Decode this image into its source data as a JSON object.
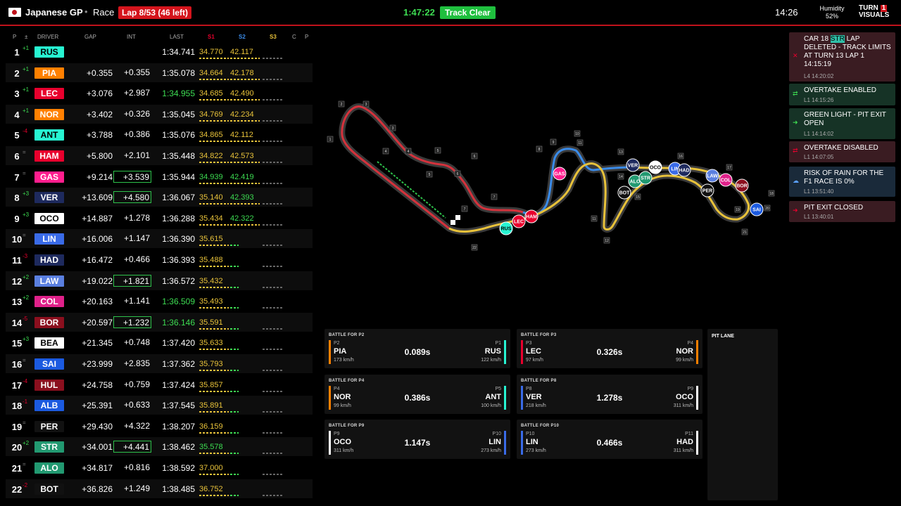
{
  "header": {
    "gp_name": "Japanese GP",
    "separator": "•",
    "session": "Race",
    "lap_badge": "Lap 8/53 (46 left)",
    "session_clock": "1:47:22",
    "track_status": "Track Clear",
    "local_time": "14:26",
    "humidity_label": "Humidity",
    "humidity_value": "52%",
    "brand_line1": "TURN",
    "brand_one": "1",
    "brand_line2": "VISUALS",
    "colors": {
      "accent": "#d4141c",
      "green": "#1fbf3e"
    }
  },
  "table": {
    "headers": {
      "p": "P",
      "chg": "±",
      "driver": "DRIVER",
      "gap": "GAP",
      "int": "INT",
      "last": "LAST",
      "s1": "S1",
      "s2": "S2",
      "s3": "S3",
      "c": "C",
      "pp": "P"
    },
    "rows": [
      {
        "pos": "1",
        "chg": "+1",
        "drv": "RUS",
        "color": "#27f4d2",
        "fg": "#000",
        "gap": "",
        "int": "",
        "last": "1:34.741",
        "s1": "34.770",
        "s2": "42.117",
        "s1c": "#e8c23a",
        "s2c": "#e8c23a",
        "lastc": "#fff",
        "box": false
      },
      {
        "pos": "2",
        "chg": "+1",
        "drv": "PIA",
        "color": "#ff8000",
        "fg": "#fff",
        "gap": "+0.355",
        "int": "+0.355",
        "last": "1:35.078",
        "s1": "34.664",
        "s2": "42.178",
        "s1c": "#e8c23a",
        "s2c": "#e8c23a",
        "lastc": "#fff",
        "box": false
      },
      {
        "pos": "3",
        "chg": "+1",
        "drv": "LEC",
        "color": "#e8002d",
        "fg": "#fff",
        "gap": "+3.076",
        "int": "+2.987",
        "last": "1:34.955",
        "s1": "34.685",
        "s2": "42.490",
        "s1c": "#e8c23a",
        "s2c": "#e8c23a",
        "lastc": "#3ddc52",
        "box": false
      },
      {
        "pos": "4",
        "chg": "+1",
        "drv": "NOR",
        "color": "#ff8000",
        "fg": "#fff",
        "gap": "+3.402",
        "int": "+0.326",
        "last": "1:35.045",
        "s1": "34.769",
        "s2": "42.234",
        "s1c": "#e8c23a",
        "s2c": "#e8c23a",
        "lastc": "#fff",
        "box": false
      },
      {
        "pos": "5",
        "chg": "-4",
        "drv": "ANT",
        "color": "#27f4d2",
        "fg": "#000",
        "gap": "+3.788",
        "int": "+0.386",
        "last": "1:35.076",
        "s1": "34.865",
        "s2": "42.112",
        "s1c": "#e8c23a",
        "s2c": "#e8c23a",
        "lastc": "#fff",
        "box": false
      },
      {
        "pos": "6",
        "chg": "=",
        "drv": "HAM",
        "color": "#e8002d",
        "fg": "#fff",
        "gap": "+5.800",
        "int": "+2.101",
        "last": "1:35.448",
        "s1": "34.822",
        "s2": "42.573",
        "s1c": "#e8c23a",
        "s2c": "#e8c23a",
        "lastc": "#fff",
        "box": false
      },
      {
        "pos": "7",
        "chg": "=",
        "drv": "GAS",
        "color": "#ff1e8e",
        "fg": "#fff",
        "gap": "+9.214",
        "int": "+3.539",
        "last": "1:35.944",
        "s1": "34.939",
        "s2": "42.419",
        "s1c": "#3ddc52",
        "s2c": "#3ddc52",
        "lastc": "#fff",
        "box": true
      },
      {
        "pos": "8",
        "chg": "+3",
        "drv": "VER",
        "color": "#1e2a5e",
        "fg": "#fff",
        "gap": "+13.609",
        "int": "+4.580",
        "last": "1:36.067",
        "s1": "35.140",
        "s2": "42.393",
        "s1c": "#e8c23a",
        "s2c": "#3ddc52",
        "lastc": "#fff",
        "box": true
      },
      {
        "pos": "9",
        "chg": "+3",
        "drv": "OCO",
        "color": "#ffffff",
        "fg": "#000",
        "gap": "+14.887",
        "int": "+1.278",
        "last": "1:36.288",
        "s1": "35.434",
        "s2": "42.322",
        "s1c": "#e8c23a",
        "s2c": "#3ddc52",
        "lastc": "#fff",
        "box": false
      },
      {
        "pos": "10",
        "chg": "=",
        "drv": "LIN",
        "color": "#3a6be8",
        "fg": "#fff",
        "gap": "+16.006",
        "int": "+1.147",
        "last": "1:36.390",
        "s1": "35.615",
        "s2": "",
        "s1c": "#e8c23a",
        "s2c": "#e8c23a",
        "lastc": "#fff",
        "box": false
      },
      {
        "pos": "11",
        "chg": "-3",
        "drv": "HAD",
        "color": "#1e2a5e",
        "fg": "#fff",
        "gap": "+16.472",
        "int": "+0.466",
        "last": "1:36.393",
        "s1": "35.488",
        "s2": "",
        "s1c": "#e8c23a",
        "s2c": "#e8c23a",
        "lastc": "#fff",
        "box": false
      },
      {
        "pos": "12",
        "chg": "+2",
        "drv": "LAW",
        "color": "#5a7fe0",
        "fg": "#fff",
        "gap": "+19.022",
        "int": "+1.821",
        "last": "1:36.572",
        "s1": "35.432",
        "s2": "",
        "s1c": "#e8c23a",
        "s2c": "#e8c23a",
        "lastc": "#fff",
        "box": true
      },
      {
        "pos": "13",
        "chg": "+2",
        "drv": "COL",
        "color": "#e0218a",
        "fg": "#fff",
        "gap": "+20.163",
        "int": "+1.141",
        "last": "1:36.509",
        "s1": "35.493",
        "s2": "",
        "s1c": "#e8c23a",
        "s2c": "#e8c23a",
        "lastc": "#3ddc52",
        "box": false
      },
      {
        "pos": "14",
        "chg": "-5",
        "drv": "BOR",
        "color": "#8b0f1e",
        "fg": "#fff",
        "gap": "+20.597",
        "int": "+1.232",
        "last": "1:36.146",
        "s1": "35.591",
        "s2": "",
        "s1c": "#e8c23a",
        "s2c": "#e8c23a",
        "lastc": "#3ddc52",
        "box": true
      },
      {
        "pos": "15",
        "chg": "+3",
        "drv": "BEA",
        "color": "#ffffff",
        "fg": "#000",
        "gap": "+21.345",
        "int": "+0.748",
        "last": "1:37.420",
        "s1": "35.633",
        "s2": "",
        "s1c": "#e8c23a",
        "s2c": "#e8c23a",
        "lastc": "#fff",
        "box": false
      },
      {
        "pos": "16",
        "chg": "=",
        "drv": "SAI",
        "color": "#1b5ae0",
        "fg": "#fff",
        "gap": "+23.999",
        "int": "+2.835",
        "last": "1:37.362",
        "s1": "35.793",
        "s2": "",
        "s1c": "#e8c23a",
        "s2c": "#e8c23a",
        "lastc": "#fff",
        "box": false
      },
      {
        "pos": "17",
        "chg": "-4",
        "drv": "HUL",
        "color": "#8b0f1e",
        "fg": "#fff",
        "gap": "+24.758",
        "int": "+0.759",
        "last": "1:37.424",
        "s1": "35.857",
        "s2": "",
        "s1c": "#e8c23a",
        "s2c": "#e8c23a",
        "lastc": "#fff",
        "box": false
      },
      {
        "pos": "18",
        "chg": "-1",
        "drv": "ALB",
        "color": "#1b5ae0",
        "fg": "#fff",
        "gap": "+25.391",
        "int": "+0.633",
        "last": "1:37.545",
        "s1": "35.891",
        "s2": "",
        "s1c": "#e8c23a",
        "s2c": "#e8c23a",
        "lastc": "#fff",
        "box": false
      },
      {
        "pos": "19",
        "chg": "=",
        "drv": "PER",
        "color": "#111111",
        "fg": "#fff",
        "gap": "+29.430",
        "int": "+4.322",
        "last": "1:38.207",
        "s1": "36.159",
        "s2": "",
        "s1c": "#e8c23a",
        "s2c": "#e8c23a",
        "lastc": "#fff",
        "box": false
      },
      {
        "pos": "20",
        "chg": "+2",
        "drv": "STR",
        "color": "#229971",
        "fg": "#fff",
        "gap": "+34.001",
        "int": "+4.441",
        "last": "1:38.462",
        "s1": "35.578",
        "s2": "",
        "s1c": "#3ddc52",
        "s2c": "#e8c23a",
        "lastc": "#fff",
        "box": true
      },
      {
        "pos": "21",
        "chg": "=",
        "drv": "ALO",
        "color": "#229971",
        "fg": "#fff",
        "gap": "+34.817",
        "int": "+0.816",
        "last": "1:38.592",
        "s1": "37.000",
        "s2": "",
        "s1c": "#e8c23a",
        "s2c": "#e8c23a",
        "lastc": "#fff",
        "box": false
      },
      {
        "pos": "22",
        "chg": "-2",
        "drv": "BOT",
        "color": "#111111",
        "fg": "#fff",
        "gap": "+36.826",
        "int": "+1.249",
        "last": "1:38.485",
        "s1": "36.752",
        "s2": "",
        "s1c": "#e8c23a",
        "s2c": "#e8c23a",
        "lastc": "#fff",
        "box": false
      }
    ]
  },
  "map": {
    "corners": [
      "1",
      "2",
      "3",
      "3",
      "4",
      "4",
      "5",
      "5",
      "6",
      "6",
      "7",
      "7",
      "8",
      "9",
      "10",
      "11",
      "11",
      "12",
      "13",
      "14",
      "15",
      "16",
      "17",
      "18",
      "19",
      "20",
      "21",
      "22"
    ],
    "cars": [
      "RUS",
      "LEC",
      "HAM",
      "GAS",
      "VER",
      "OCO",
      "LIN",
      "HAD",
      "LAW",
      "COL",
      "BOR",
      "PER",
      "SAI",
      "ALO",
      "STR",
      "BOT"
    ]
  },
  "race_control": [
    {
      "pre": "CAR 18 ",
      "hl": "STR",
      "post": " LAP DELETED - TRACK LIMITS AT TURN 13 LAP 1 14:15:19",
      "time": "L4 14:20:02",
      "kind": "red",
      "icon": "✕"
    },
    {
      "pre": "OVERTAKE ENABLED",
      "hl": "",
      "post": "",
      "time": "L1 14:15:26",
      "kind": "green",
      "icon": "⇄"
    },
    {
      "pre": "GREEN LIGHT - PIT EXIT OPEN",
      "hl": "",
      "post": "",
      "time": "L1 14:14:02",
      "kind": "green",
      "icon": "➜"
    },
    {
      "pre": "OVERTAKE DISABLED",
      "hl": "",
      "post": "",
      "time": "L1 14:07:05",
      "kind": "red",
      "icon": "⇄"
    },
    {
      "pre": "RISK OF RAIN FOR THE F1 RACE IS 0%",
      "hl": "",
      "post": "",
      "time": "L1 13:51:40",
      "kind": "blue",
      "icon": "☁"
    },
    {
      "pre": "PIT EXIT CLOSED",
      "hl": "",
      "post": "",
      "time": "L1 13:40:01",
      "kind": "red",
      "icon": "➜"
    }
  ],
  "battles": [
    {
      "title": "BATTLE FOR P2",
      "lpos": "P2",
      "ldrv": "PIA",
      "lspd": "173 km/h",
      "lcolor": "#ff8000",
      "gap": "0.089s",
      "rpos": "P1",
      "rdrv": "RUS",
      "rspd": "122 km/h",
      "rcolor": "#27f4d2"
    },
    {
      "title": "BATTLE FOR P3",
      "lpos": "P3",
      "ldrv": "LEC",
      "lspd": "97 km/h",
      "lcolor": "#e8002d",
      "gap": "0.326s",
      "rpos": "P4",
      "rdrv": "NOR",
      "rspd": "99 km/h",
      "rcolor": "#ff8000"
    },
    {
      "title": "BATTLE FOR P4",
      "lpos": "P4",
      "ldrv": "NOR",
      "lspd": "99 km/h",
      "lcolor": "#ff8000",
      "gap": "0.386s",
      "rpos": "P5",
      "rdrv": "ANT",
      "rspd": "100 km/h",
      "rcolor": "#27f4d2"
    },
    {
      "title": "BATTLE FOR P8",
      "lpos": "P8",
      "ldrv": "VER",
      "lspd": "218 km/h",
      "lcolor": "#3a6be8",
      "gap": "1.278s",
      "rpos": "P9",
      "rdrv": "OCO",
      "rspd": "311 km/h",
      "rcolor": "#ffffff"
    },
    {
      "title": "BATTLE FOR P9",
      "lpos": "P9",
      "ldrv": "OCO",
      "lspd": "311 km/h",
      "lcolor": "#ffffff",
      "gap": "1.147s",
      "rpos": "P10",
      "rdrv": "LIN",
      "rspd": "273 km/h",
      "rcolor": "#3a6be8"
    },
    {
      "title": "BATTLE FOR P10",
      "lpos": "P10",
      "ldrv": "LIN",
      "lspd": "273 km/h",
      "lcolor": "#3a6be8",
      "gap": "0.466s",
      "rpos": "P11",
      "rdrv": "HAD",
      "rspd": "311 km/h",
      "rcolor": "#ffffff"
    }
  ],
  "pit_lane": {
    "title": "PIT LANE"
  }
}
